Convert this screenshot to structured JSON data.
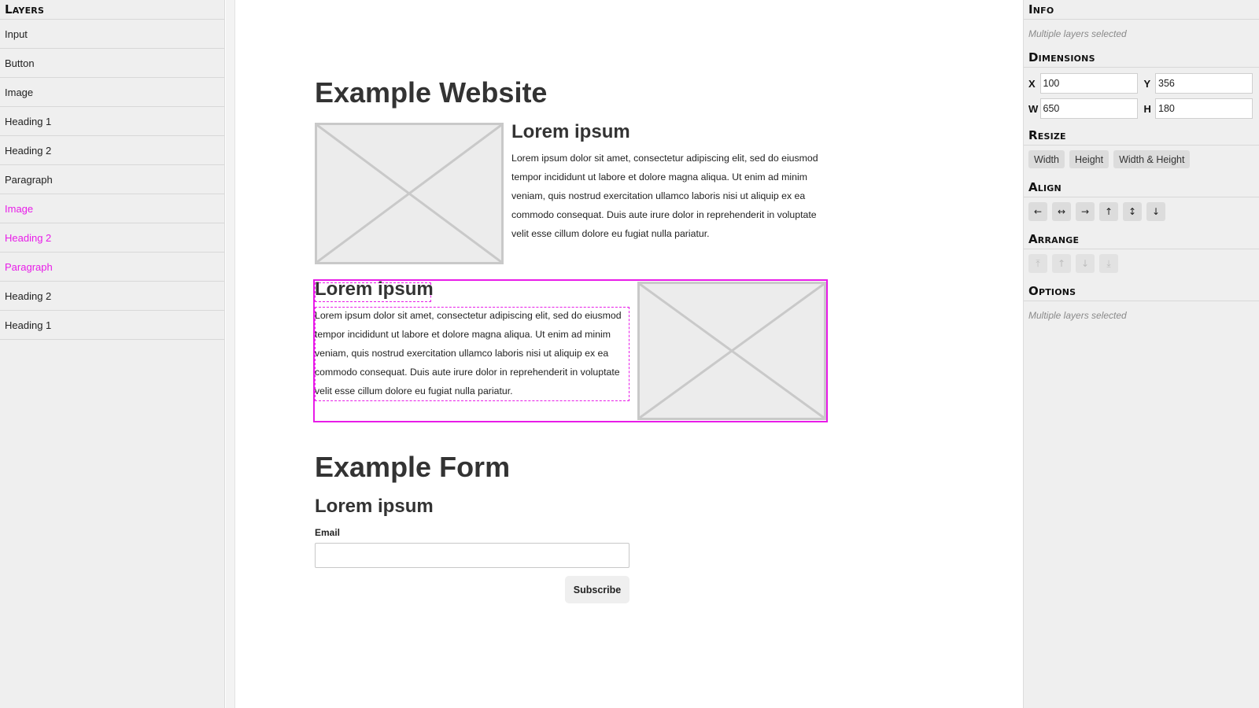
{
  "layers": {
    "title": "Layers",
    "items": [
      {
        "label": "Input",
        "selected": false
      },
      {
        "label": "Button",
        "selected": false
      },
      {
        "label": "Image",
        "selected": false
      },
      {
        "label": "Heading 1",
        "selected": false
      },
      {
        "label": "Heading 2",
        "selected": false
      },
      {
        "label": "Paragraph",
        "selected": false
      },
      {
        "label": "Image",
        "selected": true
      },
      {
        "label": "Heading 2",
        "selected": true
      },
      {
        "label": "Paragraph",
        "selected": true
      },
      {
        "label": "Heading 2",
        "selected": false
      },
      {
        "label": "Heading 1",
        "selected": false
      }
    ]
  },
  "canvas": {
    "page_heading": "Example Website",
    "section1": {
      "heading": "Lorem ipsum",
      "paragraph": "Lorem ipsum dolor sit amet, consectetur adipiscing elit, sed do eiusmod tempor incididunt ut labore et dolore magna aliqua. Ut enim ad minim veniam, quis nostrud exercitation ullamco laboris nisi ut aliquip ex ea commodo consequat. Duis aute irure dolor in reprehenderit in voluptate velit esse cillum dolore eu fugiat nulla pariatur."
    },
    "section2": {
      "heading": "Lorem ipsum",
      "paragraph": "Lorem ipsum dolor sit amet, consectetur adipiscing elit, sed do eiusmod tempor incididunt ut labore et dolore magna aliqua. Ut enim ad minim veniam, quis nostrud exercitation ullamco laboris nisi ut aliquip ex ea commodo consequat. Duis aute irure dolor in reprehenderit in voluptate velit esse cillum dolore eu fugiat nulla pariatur."
    },
    "form_heading": "Example Form",
    "form_subheading": "Lorem ipsum",
    "email_label": "Email",
    "email_value": "",
    "subscribe_label": "Subscribe"
  },
  "inspector": {
    "info_title": "Info",
    "info_note": "Multiple layers selected",
    "dimensions_title": "Dimensions",
    "x_label": "X",
    "x_value": "100",
    "y_label": "Y",
    "y_value": "356",
    "w_label": "W",
    "w_value": "650",
    "h_label": "H",
    "h_value": "180",
    "resize_title": "Resize",
    "resize_width": "Width",
    "resize_height": "Height",
    "resize_both": "Width & Height",
    "align_title": "Align",
    "align_icons": [
      "arrow-left-icon",
      "arrows-horizontal-icon",
      "arrow-right-icon",
      "arrow-up-icon",
      "arrows-vertical-icon",
      "arrow-down-icon"
    ],
    "arrange_title": "Arrange",
    "arrange_icons": [
      "bring-to-front-icon",
      "bring-forward-icon",
      "send-backward-icon",
      "send-to-back-icon"
    ],
    "options_title": "Options",
    "options_note": "Multiple layers selected"
  },
  "colors": {
    "selection": "#e81ce8",
    "panel_bg": "#efefef",
    "heading_text": "#333333"
  }
}
